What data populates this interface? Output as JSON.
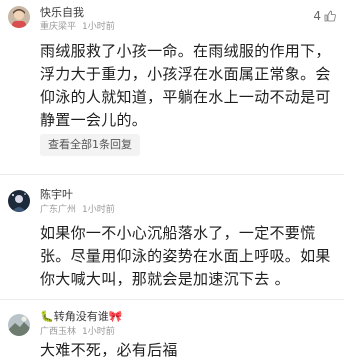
{
  "comments": [
    {
      "username": "快乐自我",
      "location": "重庆梁平",
      "time": "1小时前",
      "likes": "4",
      "text": "雨绒服救了小孩一命。在雨绒服的作用下，浮力大于重力，小孩浮在水面属正常象。会仰泳的人就知道，平躺在水上一动不动是可静置一会儿的。",
      "reply_label": "查看全部1条回复",
      "avatar_icon": "child-avatar-icon"
    },
    {
      "username": "陈宇叶",
      "location": "广东广州",
      "time": "1小时前",
      "text": "如果你一不小心沉船落水了，一定不要慌张。尽量用仰泳的姿势在水面上呼吸。如果你大喊大叫，那就会是加速沉下去 。",
      "avatar_icon": "dark-avatar-icon"
    },
    {
      "username": "🐛转角没有谁🎀",
      "location": "广西玉林",
      "time": "1小时前",
      "text": "大难不死，必有后福",
      "avatar_icon": "landscape-avatar-icon"
    }
  ]
}
